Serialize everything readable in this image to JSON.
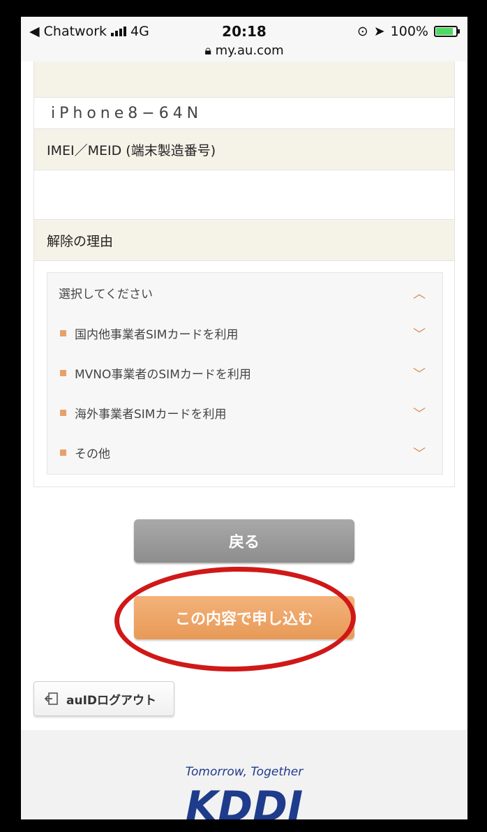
{
  "status_bar": {
    "back_app": "◀ Chatwork",
    "network": "4G",
    "time": "20:18",
    "battery_percent": "100%",
    "url": "my.au.com"
  },
  "device": {
    "model_value": "iPhone8−64N"
  },
  "imei_section": {
    "title": "IMEI／MEID (端末製造番号)",
    "value": ""
  },
  "reason_section": {
    "title": "解除の理由",
    "placeholder": "選択してください",
    "options": [
      "国内他事業者SIMカードを利用",
      "MVNO事業者のSIMカードを利用",
      "海外事業者SIMカードを利用",
      "その他"
    ]
  },
  "buttons": {
    "back_label": "戻る",
    "apply_label": "この内容で申し込む",
    "logout_label": "auIDログアウト"
  },
  "footer": {
    "tagline": "Tomorrow, Together",
    "logo_text": "KDDI"
  },
  "colors": {
    "section_header_bg": "#f5f2e8",
    "accent_orange": "#e89a57",
    "highlight_red": "#d01818",
    "brand_blue": "#1f3b8c"
  }
}
